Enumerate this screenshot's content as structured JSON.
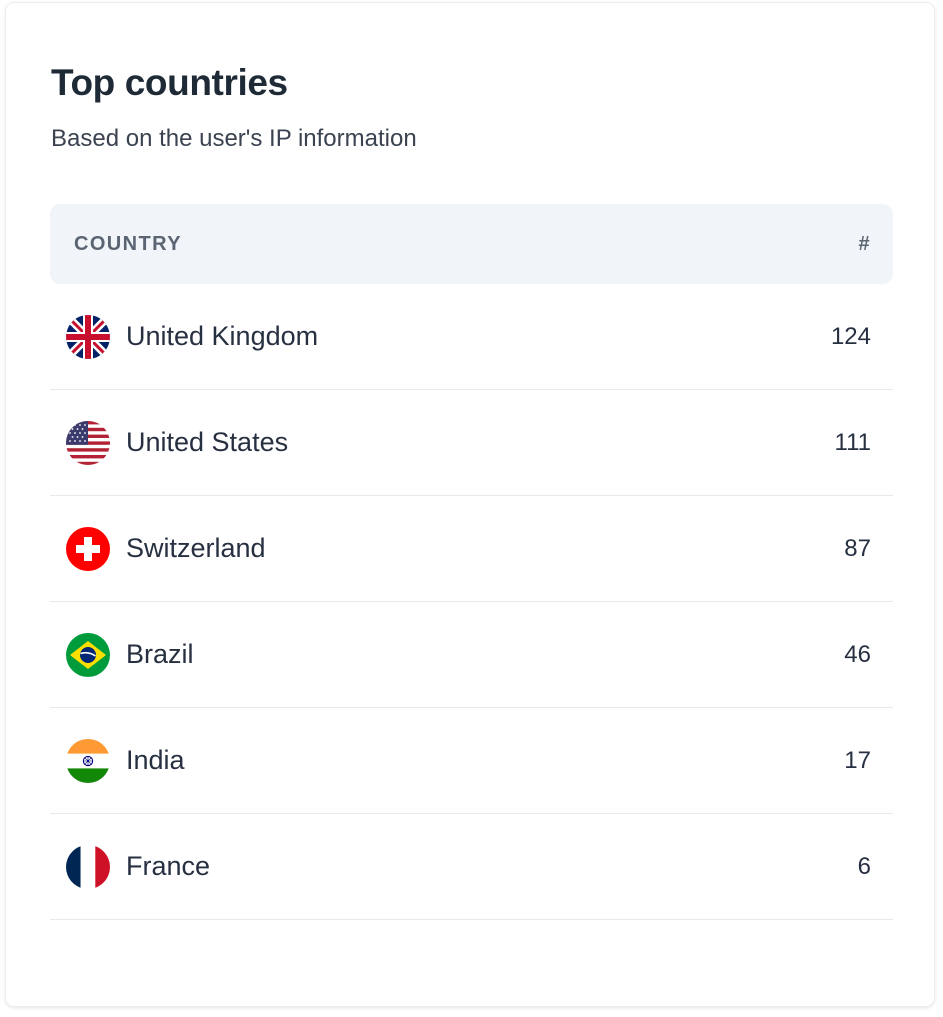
{
  "card": {
    "title": "Top countries",
    "subtitle": "Based on the user's IP information"
  },
  "table": {
    "headers": {
      "country": "COUNTRY",
      "count": "#"
    },
    "rows": [
      {
        "flag_icon": "uk-flag-icon",
        "country": "United Kingdom",
        "count": "124"
      },
      {
        "flag_icon": "us-flag-icon",
        "country": "United States",
        "count": "111"
      },
      {
        "flag_icon": "switzerland-flag-icon",
        "country": "Switzerland",
        "count": "87"
      },
      {
        "flag_icon": "brazil-flag-icon",
        "country": "Brazil",
        "count": "46"
      },
      {
        "flag_icon": "india-flag-icon",
        "country": "India",
        "count": "17"
      },
      {
        "flag_icon": "france-flag-icon",
        "country": "France",
        "count": "6"
      }
    ]
  },
  "colors": {
    "header_bg": "#f1f4f9",
    "text": "#273041",
    "divider": "#e6e9ee"
  }
}
